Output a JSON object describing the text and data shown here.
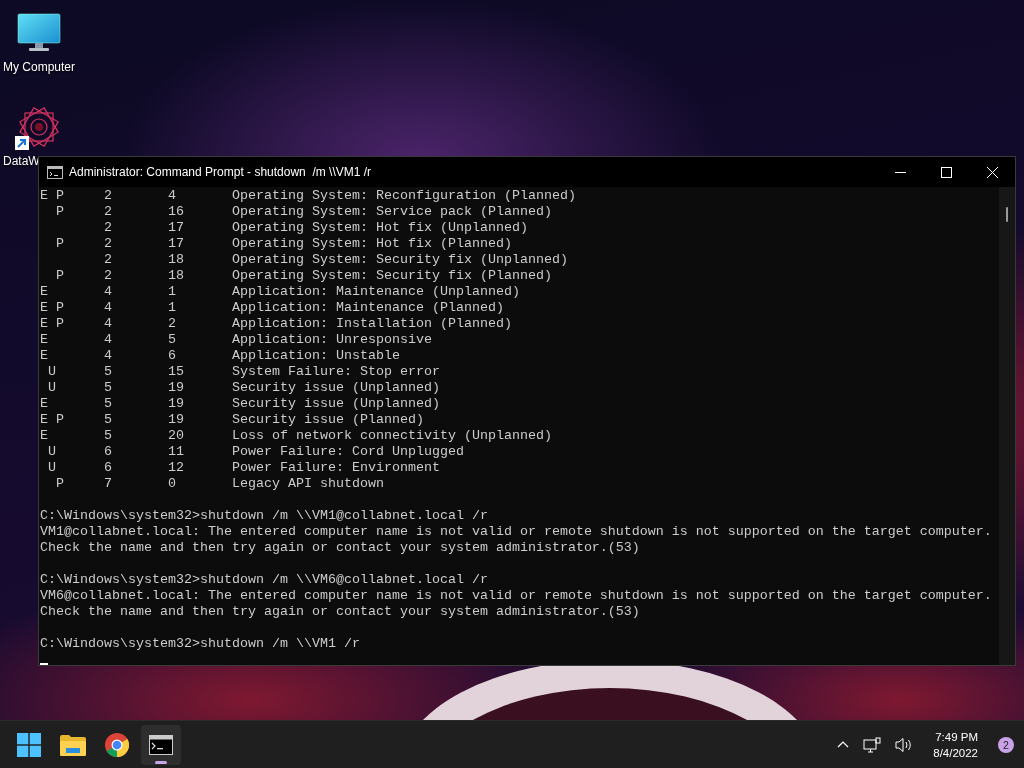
{
  "desktop": {
    "icons": [
      {
        "kind": "computer",
        "label": "My Computer",
        "shortcut": false
      },
      {
        "kind": "app",
        "label": "DataW",
        "shortcut": true
      }
    ]
  },
  "window": {
    "title": "Administrator: Command Prompt - shutdown  /m \\\\VM1 /r",
    "console": {
      "blocks": [
        {
          "lines": [
            "E P     2       4       Operating System: Reconfiguration (Planned)",
            "  P     2       16      Operating System: Service pack (Planned)",
            "        2       17      Operating System: Hot fix (Unplanned)",
            "  P     2       17      Operating System: Hot fix (Planned)",
            "        2       18      Operating System: Security fix (Unplanned)",
            "  P     2       18      Operating System: Security fix (Planned)",
            "E       4       1       Application: Maintenance (Unplanned)",
            "E P     4       1       Application: Maintenance (Planned)",
            "E P     4       2       Application: Installation (Planned)",
            "E       4       5       Application: Unresponsive",
            "E       4       6       Application: Unstable",
            " U      5       15      System Failure: Stop error",
            " U      5       19      Security issue (Unplanned)",
            "E       5       19      Security issue (Unplanned)",
            "E P     5       19      Security issue (Planned)",
            "E       5       20      Loss of network connectivity (Unplanned)",
            " U      6       11      Power Failure: Cord Unplugged",
            " U      6       12      Power Failure: Environment",
            "  P     7       0       Legacy API shutdown"
          ]
        },
        {
          "lines": [
            "C:\\Windows\\system32>shutdown /m \\\\VM1@collabnet.local /r",
            "VM1@collabnet.local: The entered computer name is not valid or remote shutdown is not supported on the target computer.",
            "Check the name and then try again or contact your system administrator.(53)"
          ]
        },
        {
          "lines": [
            "C:\\Windows\\system32>shutdown /m \\\\VM6@collabnet.local /r",
            "VM6@collabnet.local: The entered computer name is not valid or remote shutdown is not supported on the target computer.",
            "Check the name and then try again or contact your system administrator.(53)"
          ]
        },
        {
          "lines": [
            "C:\\Windows\\system32>shutdown /m \\\\VM1 /r"
          ]
        }
      ]
    }
  },
  "taskbar": {
    "apps": [
      {
        "kind": "start",
        "selected": false
      },
      {
        "kind": "folder",
        "selected": false
      },
      {
        "kind": "browser",
        "selected": false
      },
      {
        "kind": "terminal",
        "selected": true
      }
    ],
    "tray": {
      "time": "7:49 PM",
      "date": "8/4/2022",
      "notifications": "2"
    }
  }
}
